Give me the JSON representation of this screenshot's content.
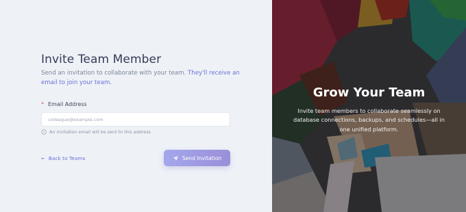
{
  "form": {
    "title": "Invite Team Member",
    "description_plain": "Send an invitation to collaborate with your team. ",
    "description_highlight": "They'll receive an email to join your team.",
    "required_mark": "*",
    "email_label": "Email Address",
    "email_placeholder": "colleague@example.com",
    "email_value": "",
    "hint": "An invitation email will be sent to this address",
    "back_label": "Back to Teams",
    "send_label": "Send Invitation"
  },
  "promo": {
    "title": "Grow Your Team",
    "text": "Invite team members to collaborate seamlessly on database connections, backups, and schedules—all in one unified platform."
  },
  "colors": {
    "accent": "#6b70d2",
    "button_gradient_start": "#a3a7ec",
    "button_gradient_end": "#9a8fd8",
    "required": "#e0515b",
    "left_background": "#eef2f7"
  },
  "icons": {
    "hint": "info-circle-icon",
    "back": "arrow-left-icon",
    "send": "paper-plane-icon"
  }
}
